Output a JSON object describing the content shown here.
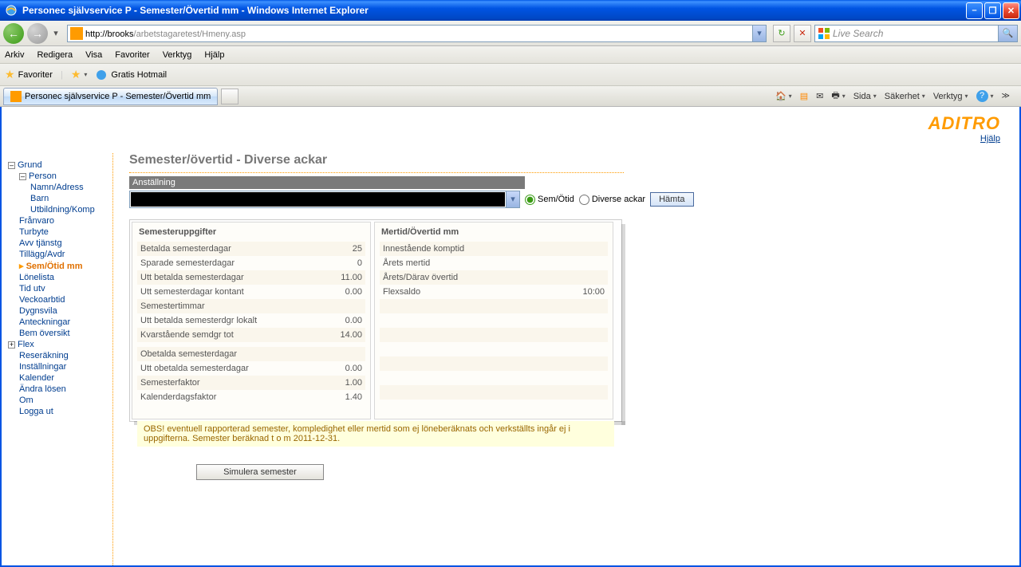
{
  "window": {
    "title": "Personec självservice P - Semester/Övertid mm - Windows Internet Explorer"
  },
  "address": {
    "prefix": "http://brooks",
    "suffix": "/arbetstagaretest/Hmeny.asp"
  },
  "menu": {
    "arkiv": "Arkiv",
    "redigera": "Redigera",
    "visa": "Visa",
    "favoriter": "Favoriter",
    "verktyg": "Verktyg",
    "hjalp": "Hjälp"
  },
  "favbar": {
    "favoriter": "Favoriter",
    "hotmail": "Gratis Hotmail"
  },
  "tab": {
    "label": "Personec självservice P - Semester/Övertid mm"
  },
  "cmdbar": {
    "sida": "Sida",
    "sakerhet": "Säkerhet",
    "verktyg": "Verktyg"
  },
  "search": {
    "placeholder": "Live Search"
  },
  "brand": {
    "logo": "ADITRO",
    "help": "Hjälp"
  },
  "nav": {
    "grund": "Grund",
    "person": "Person",
    "namn": "Namn/Adress",
    "barn": "Barn",
    "utb": "Utbildning/Komp",
    "franvaro": "Frånvaro",
    "turbyte": "Turbyte",
    "avv": "Avv tjänstg",
    "tillagg": "Tillägg/Avdr",
    "semotid": "Sem/Ötid mm",
    "lonelista": "Lönelista",
    "tidutv": "Tid utv",
    "vecko": "Veckoarbtid",
    "dygns": "Dygnsvila",
    "anteck": "Anteckningar",
    "bem": "Bem översikt",
    "flex": "Flex",
    "reser": "Reseräkning",
    "install": "Inställningar",
    "kalender": "Kalender",
    "andra": "Ändra lösen",
    "om": "Om",
    "logga": "Logga ut"
  },
  "page": {
    "title": "Semester/övertid - Diverse ackar",
    "section": "Anställning",
    "radio1": "Sem/Ötid",
    "radio2": "Diverse ackar",
    "fetch": "Hämta",
    "panel1": "Semesteruppgifter",
    "panel2": "Mertid/Övertid mm",
    "note": "OBS! eventuell rapporterad semester, kompledighet eller mertid som ej löneberäknats och verkställts ingår ej i uppgifterna. Semester beräknad t o m 2011-12-31.",
    "simulate": "Simulera semester"
  },
  "sem": [
    {
      "k": "Betalda semesterdagar",
      "v": "25"
    },
    {
      "k": "Sparade semesterdagar",
      "v": "0"
    },
    {
      "k": "Utt betalda semesterdagar",
      "v": "11.00"
    },
    {
      "k": "Utt semesterdagar kontant",
      "v": "0.00"
    },
    {
      "k": "Semestertimmar",
      "v": ""
    },
    {
      "k": "Utt betalda semesterdgr lokalt",
      "v": "0.00"
    },
    {
      "k": "Kvarstående semdgr tot",
      "v": "14.00"
    },
    {
      "k": "",
      "v": ""
    },
    {
      "k": "Obetalda semesterdagar",
      "v": ""
    },
    {
      "k": "Utt obetalda semesterdagar",
      "v": "0.00"
    },
    {
      "k": "Semesterfaktor",
      "v": "1.00"
    },
    {
      "k": "Kalenderdagsfaktor",
      "v": "1.40"
    }
  ],
  "mer": [
    {
      "k": "Innestående komptid",
      "v": ""
    },
    {
      "k": "Årets mertid",
      "v": ""
    },
    {
      "k": "Årets/Därav övertid",
      "v": ""
    },
    {
      "k": "Flexsaldo",
      "v": "10:00"
    }
  ]
}
